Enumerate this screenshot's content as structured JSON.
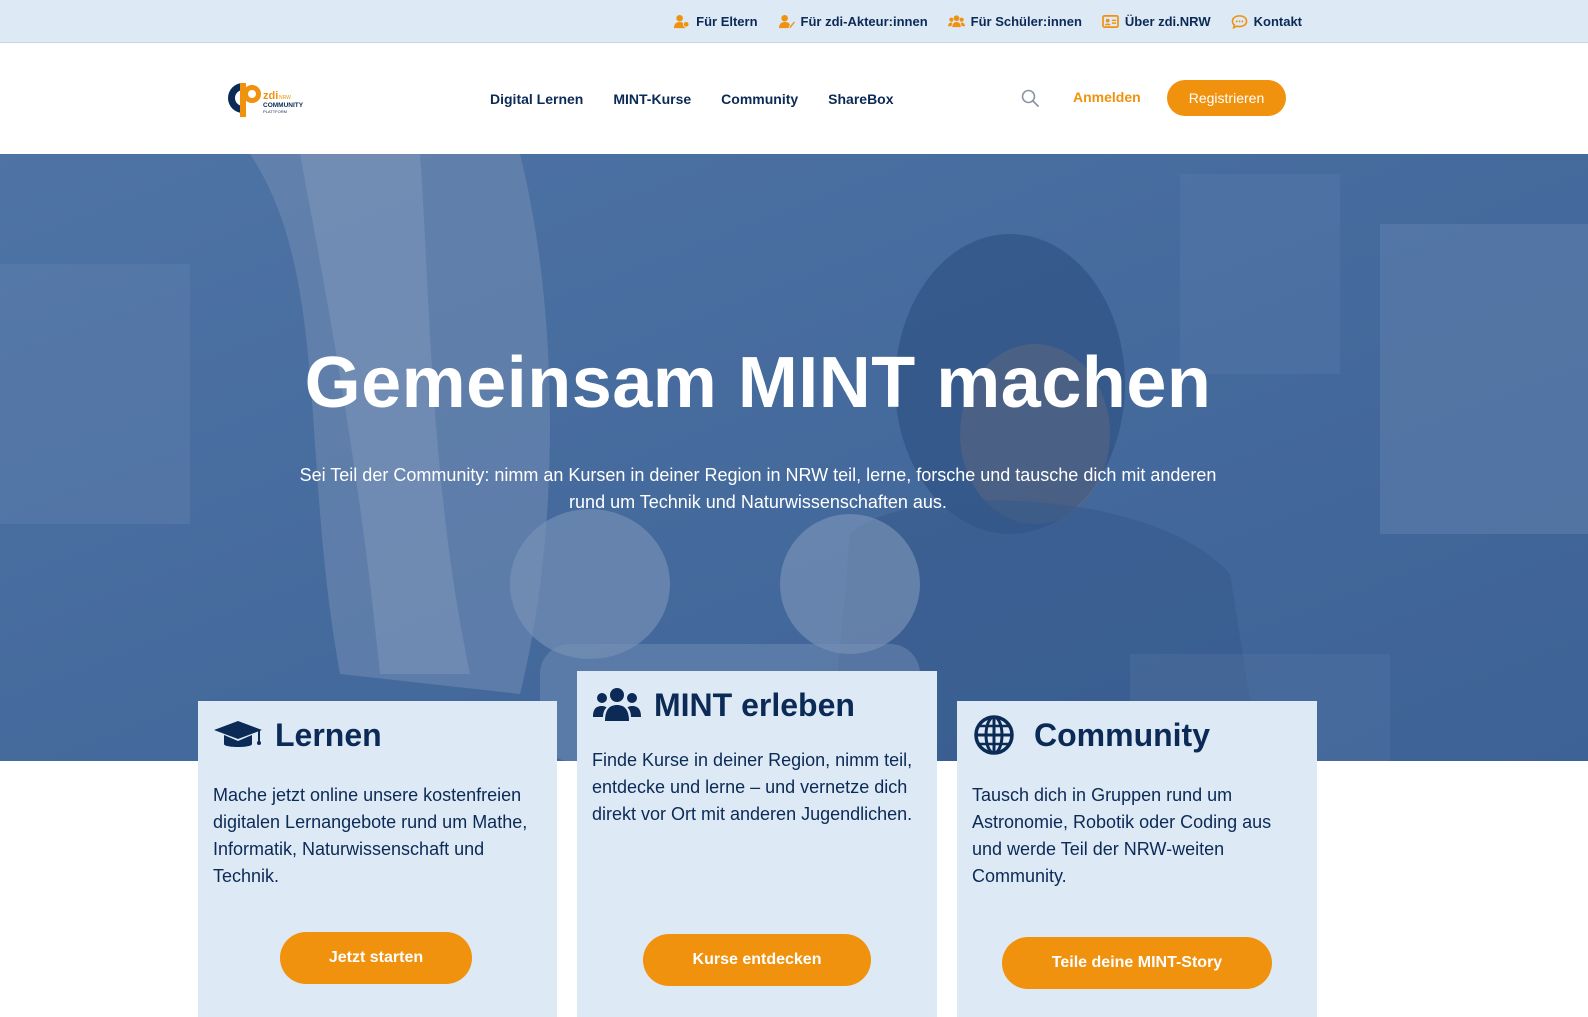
{
  "topbar": {
    "links": [
      {
        "label": "Für Eltern",
        "icon": "parent-icon"
      },
      {
        "label": "Für zdi-Akteur:innen",
        "icon": "user-edit-icon"
      },
      {
        "label": "Für Schüler:innen",
        "icon": "users-icon"
      },
      {
        "label": "Über zdi.NRW",
        "icon": "id-card-icon"
      },
      {
        "label": "Kontakt",
        "icon": "chat-icon"
      }
    ]
  },
  "header": {
    "logo": {
      "brand": "zdi",
      "region": "NRW",
      "line1": "COMMUNITY",
      "line2": "PLATTFORM"
    },
    "nav": [
      "Digital Lernen",
      "MINT-Kurse",
      "Community",
      "ShareBox"
    ],
    "login_label": "Anmelden",
    "register_label": "Registrieren"
  },
  "hero": {
    "title": "Gemeinsam MINT machen",
    "subtitle": "Sei Teil der Community: nimm an Kursen in deiner Region in NRW teil, lerne, forsche und tausche dich mit anderen rund um Technik und Naturwissenschaften aus."
  },
  "cards": [
    {
      "icon": "graduation-cap-icon",
      "title": "Lernen",
      "text": "Mache jetzt online unsere kostenfreien digitalen Lernangebote rund um Mathe, Informatik, Naturwissenschaft und Technik.",
      "button": "Jetzt starten"
    },
    {
      "icon": "users-group-icon",
      "title": "MINT erleben",
      "text": "Finde Kurse in deiner Region, nimm teil, entdecke und lerne – und vernetze dich direkt vor Ort mit anderen Jugendlichen.",
      "button": "Kurse entdecken"
    },
    {
      "icon": "globe-icon",
      "title": "Community",
      "text": "Tausch dich in Gruppen rund um Astronomie, Robotik oder Coding aus und werde Teil der NRW-weiten Community.",
      "button": "Teile deine MINT-Story"
    }
  ],
  "colors": {
    "accent": "#f0920e",
    "navy": "#0b2a55",
    "light_blue": "#dde9f5"
  }
}
